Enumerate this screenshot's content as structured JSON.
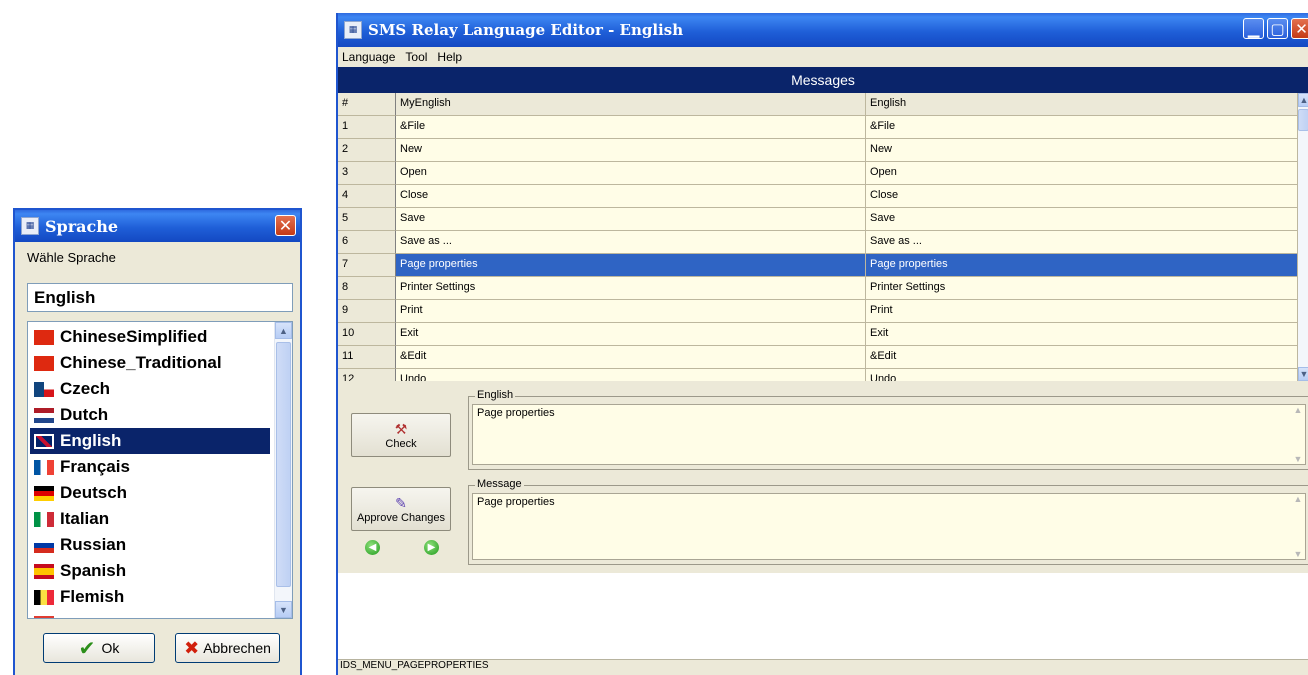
{
  "sprache_dialog": {
    "title": "Sprache",
    "label": "Wähle Sprache",
    "selected_value": "English",
    "languages": [
      {
        "name": "ChineseSimplified",
        "flag": "china-flag-icon"
      },
      {
        "name": "Chinese_Traditional",
        "flag": "china-flag-icon"
      },
      {
        "name": "Czech",
        "flag": "czech-flag-icon"
      },
      {
        "name": "Dutch",
        "flag": "dutch-flag-icon"
      },
      {
        "name": "English",
        "flag": "uk-flag-icon",
        "selected": true
      },
      {
        "name": "Français",
        "flag": "french-flag-icon"
      },
      {
        "name": "Deutsch",
        "flag": "german-flag-icon"
      },
      {
        "name": "Italian",
        "flag": "italian-flag-icon"
      },
      {
        "name": "Russian",
        "flag": "russian-flag-icon"
      },
      {
        "name": "Spanish",
        "flag": "spanish-flag-icon"
      },
      {
        "name": "Flemish",
        "flag": "belgian-flag-icon"
      },
      {
        "name": "",
        "flag": "south-africa-flag-icon"
      }
    ],
    "ok_label": "Ok",
    "cancel_label": "Abbrechen"
  },
  "editor": {
    "title": "SMS Relay Language Editor - English",
    "menu": [
      "Language",
      "Tool",
      "Help"
    ],
    "messages_header": "Messages",
    "columns": [
      "#",
      "MyEnglish",
      "English"
    ],
    "rows": [
      {
        "id": "1",
        "my": "&File",
        "en": "&File"
      },
      {
        "id": "2",
        "my": "New",
        "en": "New"
      },
      {
        "id": "3",
        "my": "Open",
        "en": "Open"
      },
      {
        "id": "4",
        "my": "Close",
        "en": "Close"
      },
      {
        "id": "5",
        "my": "Save",
        "en": "Save"
      },
      {
        "id": "6",
        "my": "Save as ...",
        "en": "Save as ..."
      },
      {
        "id": "7",
        "my": "Page properties",
        "en": "Page properties",
        "selected": true
      },
      {
        "id": "8",
        "my": "Printer Settings",
        "en": "Printer Settings"
      },
      {
        "id": "9",
        "my": "Print",
        "en": "Print"
      },
      {
        "id": "10",
        "my": "Exit",
        "en": "Exit"
      },
      {
        "id": "11",
        "my": "&Edit",
        "en": "&Edit"
      },
      {
        "id": "12",
        "my": "Undo",
        "en": "Undo"
      }
    ],
    "english_label": "English",
    "english_text": "Page properties",
    "message_label": "Message",
    "message_text": "Page properties",
    "check_label": "Check",
    "approve_label": "Approve Changes",
    "status": "IDS_MENU_PAGEPROPERTIES"
  },
  "colors": {
    "title_blue": "#1f5fd8",
    "selection": "#0a246a",
    "grid_selection": "#2f64c4",
    "grid_bg": "#fffde7"
  }
}
